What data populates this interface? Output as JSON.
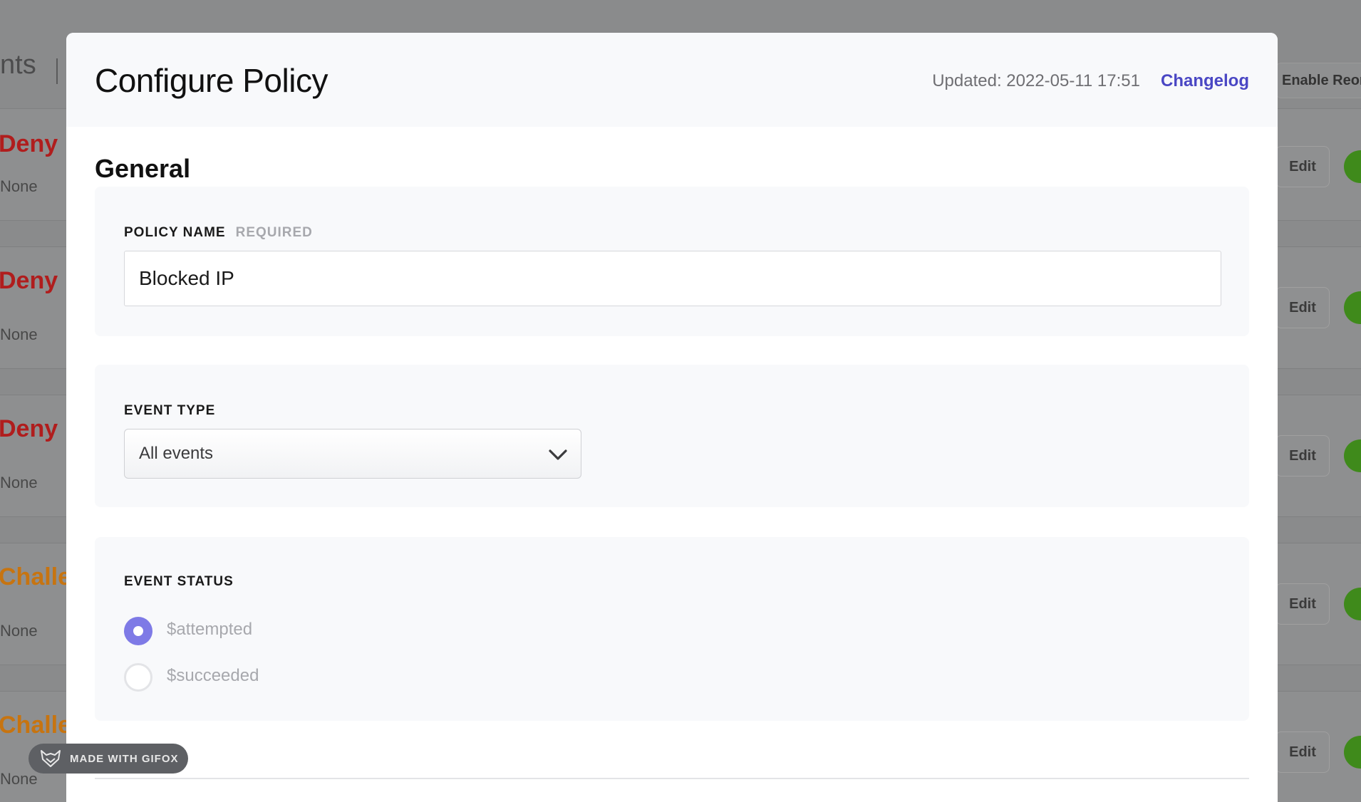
{
  "background": {
    "page_title_fragment": "nts",
    "reorder_button": "Enable Reorder",
    "rows": [
      {
        "action": "Deny",
        "sub": "None",
        "action_color": "#b01d1d",
        "edit": "Edit"
      },
      {
        "action": "Deny",
        "sub": "None",
        "action_color": "#b01d1d",
        "edit": "Edit"
      },
      {
        "action": "Deny",
        "sub": "None",
        "action_color": "#b01d1d",
        "edit": "Edit"
      },
      {
        "action": "Challenge",
        "sub": "None",
        "action_color": "#c77410",
        "edit": "Edit"
      },
      {
        "action": "Challenge",
        "sub": "None",
        "action_color": "#c77410",
        "edit": "Edit"
      }
    ]
  },
  "modal": {
    "title": "Configure Policy",
    "updated": "Updated: 2022-05-11 17:51",
    "changelog": "Changelog",
    "section_title": "General",
    "policy_name": {
      "label": "POLICY NAME",
      "required": "REQUIRED",
      "value": "Blocked IP"
    },
    "event_type": {
      "label": "EVENT TYPE",
      "selected": "All events"
    },
    "event_status": {
      "label": "EVENT STATUS",
      "options": [
        {
          "label": "$attempted",
          "checked": true
        },
        {
          "label": "$succeeded",
          "checked": false
        }
      ]
    }
  },
  "watermark": "MADE WITH GIFOX",
  "colors": {
    "accent": "#4a47c4",
    "radio_checked": "#7e7ae6",
    "toggle_on": "#3f8a1b"
  }
}
